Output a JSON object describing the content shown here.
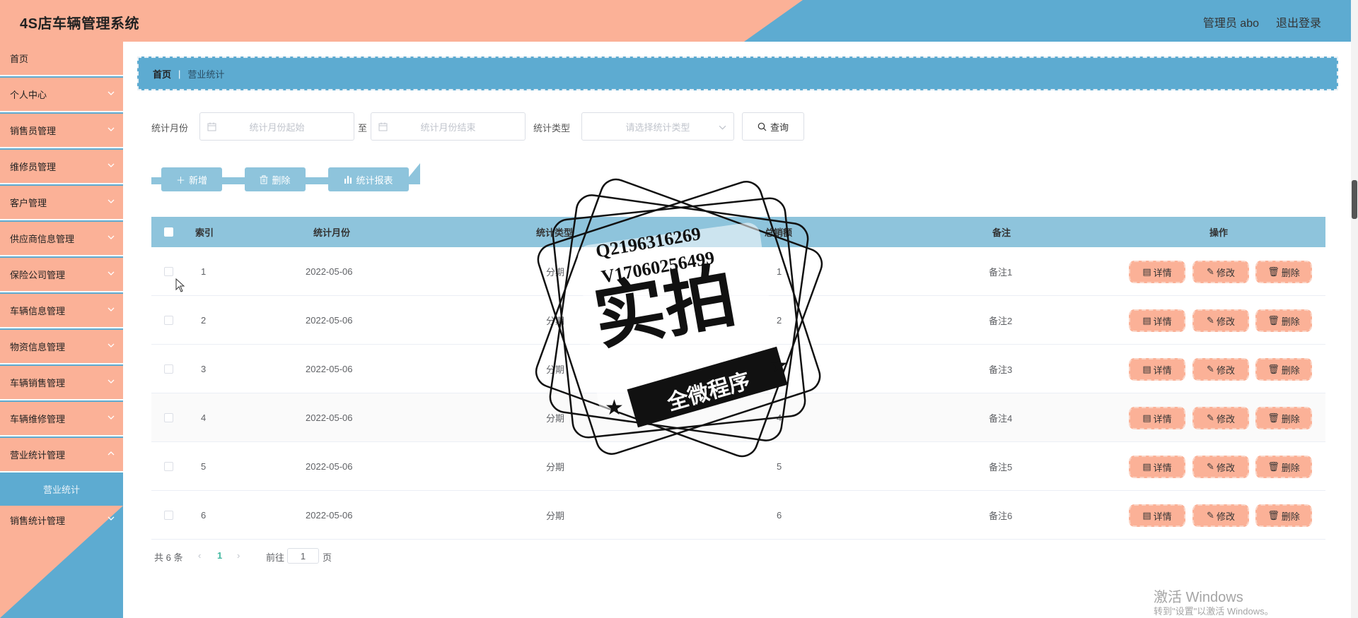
{
  "app": {
    "title": "4S店车辆管理系统"
  },
  "header": {
    "user": "管理员 abo",
    "logout": "退出登录"
  },
  "sidebar": {
    "home": "首页",
    "items": [
      {
        "label": "个人中心"
      },
      {
        "label": "销售员管理"
      },
      {
        "label": "维修员管理"
      },
      {
        "label": "客户管理"
      },
      {
        "label": "供应商信息管理"
      },
      {
        "label": "保险公司管理"
      },
      {
        "label": "车辆信息管理"
      },
      {
        "label": "物资信息管理"
      },
      {
        "label": "车辆销售管理"
      },
      {
        "label": "车辆维修管理"
      },
      {
        "label": "营业统计管理"
      }
    ],
    "active_sub": "营业统计",
    "last_item": "销售统计管理"
  },
  "breadcrumb": {
    "home": "首页",
    "separator": "|",
    "current": "营业统计"
  },
  "search": {
    "month_label": "统计月份",
    "start_placeholder": "统计月份起始",
    "to_label": "至",
    "end_placeholder": "统计月份结束",
    "type_label": "统计类型",
    "type_placeholder": "请选择统计类型",
    "query_button": "查询"
  },
  "actions": {
    "add": "新增",
    "delete": "删除",
    "report": "统计报表"
  },
  "table": {
    "headers": [
      "索引",
      "统计月份",
      "统计类型",
      "总销额",
      "备注",
      "操作"
    ],
    "rows": [
      {
        "index": "1",
        "month": "2022-05-06",
        "type": "分期",
        "total": "1",
        "remark": "备注1"
      },
      {
        "index": "2",
        "month": "2022-05-06",
        "type": "分期",
        "total": "2",
        "remark": "备注2"
      },
      {
        "index": "3",
        "month": "2022-05-06",
        "type": "分期",
        "total": "3",
        "remark": "备注3"
      },
      {
        "index": "4",
        "month": "2022-05-06",
        "type": "分期",
        "total": "4",
        "remark": "备注4"
      },
      {
        "index": "5",
        "month": "2022-05-06",
        "type": "分期",
        "total": "5",
        "remark": "备注5"
      },
      {
        "index": "6",
        "month": "2022-05-06",
        "type": "分期",
        "total": "6",
        "remark": "备注6"
      }
    ],
    "op_detail": "详情",
    "op_edit": "修改",
    "op_delete": "删除"
  },
  "pagination": {
    "total": "共 6 条",
    "page": "1",
    "goto": "前往",
    "goto_value": "1",
    "page_unit": "页"
  },
  "watermark": {
    "qq": "Q2196316269",
    "wx": "V17060256499",
    "big": "实拍",
    "ribbon": "全微程序"
  },
  "windows": {
    "line1": "激活 Windows",
    "line2": "转到\"设置\"以激活 Windows。"
  },
  "colors": {
    "salmon": "#fbb197",
    "blue": "#5dabd1",
    "light_blue": "#8ec4dc"
  }
}
